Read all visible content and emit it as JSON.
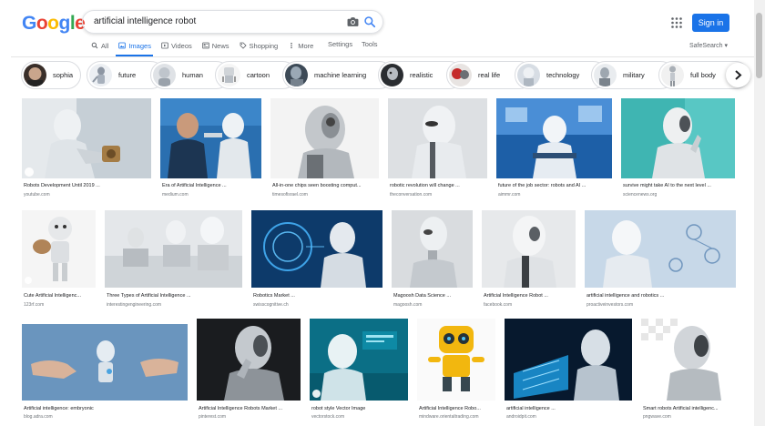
{
  "colors": {
    "accent": "#1a73e8",
    "g_blue": "#4285f4",
    "g_red": "#ea4335",
    "g_yellow": "#fbbc05",
    "g_green": "#34a853"
  },
  "logo": {
    "l1": "G",
    "l2": "o",
    "l3": "o",
    "l4": "g",
    "l5": "l",
    "l6": "e"
  },
  "search": {
    "query": "artificial intelligence robot",
    "camera_icon": "camera-icon",
    "search_icon": "search-icon"
  },
  "header": {
    "apps_icon": "apps-grid-icon",
    "signin_label": "Sign in"
  },
  "tabs": [
    {
      "label": "All",
      "icon": "search-icon"
    },
    {
      "label": "Images",
      "icon": "image-icon"
    },
    {
      "label": "Videos",
      "icon": "video-icon"
    },
    {
      "label": "News",
      "icon": "news-icon"
    },
    {
      "label": "Shopping",
      "icon": "tag-icon"
    },
    {
      "label": "More",
      "icon": "more-vert-icon"
    }
  ],
  "settings_label": "Settings",
  "tools_label": "Tools",
  "safesearch_label": "SafeSearch ▾",
  "chips": [
    {
      "label": "sophia"
    },
    {
      "label": "future"
    },
    {
      "label": "human"
    },
    {
      "label": "cartoon"
    },
    {
      "label": "machine learning"
    },
    {
      "label": "realistic"
    },
    {
      "label": "real life"
    },
    {
      "label": "technology"
    },
    {
      "label": "military"
    },
    {
      "label": "full body"
    }
  ],
  "results": [
    {
      "title": "Robots Development Until 2019 ...",
      "source": "youtube.com"
    },
    {
      "title": "Era of Artificial Intelligence ...",
      "source": "medium.com"
    },
    {
      "title": "All-in-one chips seen boosting comput...",
      "source": "timesofisrael.com"
    },
    {
      "title": "robotic revolution will change ...",
      "source": "theconversation.com"
    },
    {
      "title": "future of the job sector: robots and AI ...",
      "source": "aimmr.com"
    },
    {
      "title": "survive might take AI to the next level ...",
      "source": "sciencenews.org"
    },
    {
      "title": "Cute Artificial Intelligenc...",
      "source": "123rf.com"
    },
    {
      "title": "Three Types of Artificial Intelligence ...",
      "source": "interestingengineering.com"
    },
    {
      "title": "Robotics Market ...",
      "source": "swisscognitive.ch"
    },
    {
      "title": "Magoosh Data Science ...",
      "source": "magoosh.com"
    },
    {
      "title": "Artificial Intelligence Robot ...",
      "source": "facebook.com"
    },
    {
      "title": "artificial intelligence and robotics ...",
      "source": "proactiveinvestors.com"
    },
    {
      "title": "Artificial intelligence: embryonic",
      "source": "blog.adra.com"
    },
    {
      "title": "Artificial Intelligence Robots Market ...",
      "source": "pinterest.com"
    },
    {
      "title": "robot style Vector Image",
      "source": "vectorstock.com"
    },
    {
      "title": "Artificial Intelligence Robo...",
      "source": "mindware.orientaltrading.com"
    },
    {
      "title": "artificial intelligence ...",
      "source": "androidpit.com"
    },
    {
      "title": "Smart robots Artificial intelligenc...",
      "source": "pngwave.com"
    }
  ]
}
